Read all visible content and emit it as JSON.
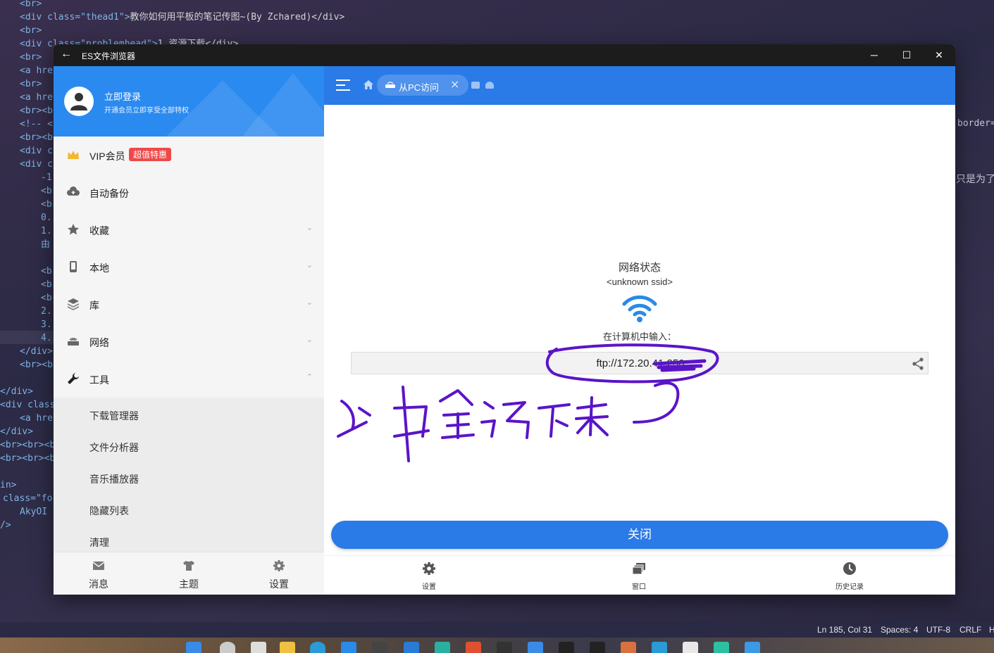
{
  "editor": {
    "code_lines": [
      {
        "html_tag": "<br>",
        "text": ""
      },
      {
        "html_tag": "<div class=\"thead1\">",
        "text": "教你如何用平板的笔记传图~(By Zchared)</div>"
      },
      {
        "html_tag": "<br>",
        "text": ""
      },
      {
        "html_tag": "<div class=\"problemhead\">",
        "text": "1.资源下载</div>"
      },
      {
        "html_tag": "<br>",
        "text": ""
      },
      {
        "html_tag": "<a hre",
        "text": ""
      },
      {
        "html_tag": "<br>",
        "text": ""
      },
      {
        "html_tag": "<a hre",
        "text": ""
      },
      {
        "html_tag": "<br><b",
        "text": ""
      },
      {
        "html_tag": "<!-- <",
        "text": ""
      },
      {
        "html_tag": "<br><b",
        "text": ""
      },
      {
        "html_tag": "<div c",
        "text": ""
      },
      {
        "html_tag": "<div c",
        "text": ""
      },
      {
        "html_tag": "-1",
        "text": ""
      },
      {
        "html_tag": "<br",
        "text": ""
      },
      {
        "html_tag": "<br",
        "text": ""
      },
      {
        "html_tag": "0.",
        "text": ""
      },
      {
        "html_tag": "1.",
        "text": ""
      },
      {
        "html_tag": "由",
        "text": ""
      },
      {
        "html_tag": "",
        "text": ""
      },
      {
        "html_tag": "<br",
        "text": ""
      },
      {
        "html_tag": "<br",
        "text": ""
      },
      {
        "html_tag": "<br",
        "text": ""
      },
      {
        "html_tag": "2.",
        "text": ""
      },
      {
        "html_tag": "3.",
        "text": ""
      },
      {
        "html_tag": "4.",
        "text": ""
      },
      {
        "html_tag": "</div>",
        "text": ""
      },
      {
        "html_tag": "<br><b",
        "text": ""
      },
      {
        "html_tag": "",
        "text": ""
      },
      {
        "html_tag": "</div>",
        "text": ""
      },
      {
        "html_tag": "<div class",
        "text": ""
      },
      {
        "html_tag": "<a hre",
        "text": ""
      },
      {
        "html_tag": "</div>",
        "text": ""
      },
      {
        "html_tag": "<br><br><b",
        "text": ""
      },
      {
        "html_tag": "<br><br><b",
        "text": ""
      },
      {
        "html_tag": "",
        "text": ""
      },
      {
        "html_tag": "in>",
        "text": ""
      },
      {
        "html_tag": "class=\"fo",
        "text": ""
      },
      {
        "html_tag": "AkyOI",
        "text": ""
      },
      {
        "html_tag": "/>",
        "text": ""
      }
    ],
    "right_side_text_1": "border=",
    "right_side_text_2": "只是为了"
  },
  "status_bar": {
    "position": "Ln 185, Col 31",
    "spaces": "Spaces: 4",
    "encoding": "UTF-8",
    "eol": "CRLF",
    "extra": "H"
  },
  "window": {
    "title": "ES文件浏览器",
    "back_icon": "←",
    "minimize_icon": "─",
    "maximize_icon": "☐",
    "close_icon": "✕"
  },
  "sidebar": {
    "login_title": "立即登录",
    "login_subtitle": "开通会员立即享受全部特权",
    "vip_label": "VIP会员",
    "vip_badge": "超值特惠",
    "items": [
      {
        "label": "自动备份",
        "icon": "cloud-icon"
      },
      {
        "label": "收藏",
        "icon": "star-icon"
      },
      {
        "label": "本地",
        "icon": "phone-icon"
      },
      {
        "label": "库",
        "icon": "layers-icon"
      },
      {
        "label": "网络",
        "icon": "router-icon"
      },
      {
        "label": "工具",
        "icon": "wrench-icon"
      }
    ],
    "tools_subitems": [
      "下载管理器",
      "文件分析器",
      "音乐播放器",
      "隐藏列表",
      "清理"
    ],
    "bottom_tabs": [
      {
        "label": "消息",
        "icon": "mail-icon"
      },
      {
        "label": "主题",
        "icon": "shirt-icon"
      },
      {
        "label": "设置",
        "icon": "gear-icon"
      }
    ]
  },
  "main": {
    "tab_label": "从PC访问",
    "network_status_title": "网络状态",
    "ssid": "<unknown ssid>",
    "enter_label": "在计算机中输入：",
    "ftp_url": "ftp://172.20.41.250",
    "close_button": "关闭",
    "bottom_tabs": [
      {
        "label": "设置",
        "icon": "gear-icon"
      },
      {
        "label": "窗口",
        "icon": "windows-icon"
      },
      {
        "label": "历史记录",
        "icon": "clock-icon"
      }
    ]
  },
  "annotation": {
    "handwritten_text": "这串全记下来",
    "ink_color": "#5a14c8"
  },
  "colors": {
    "accent_blue": "#2a7ae8",
    "sidebar_header_blue": "#2a8af0",
    "vip_badge_red": "#f04848"
  }
}
